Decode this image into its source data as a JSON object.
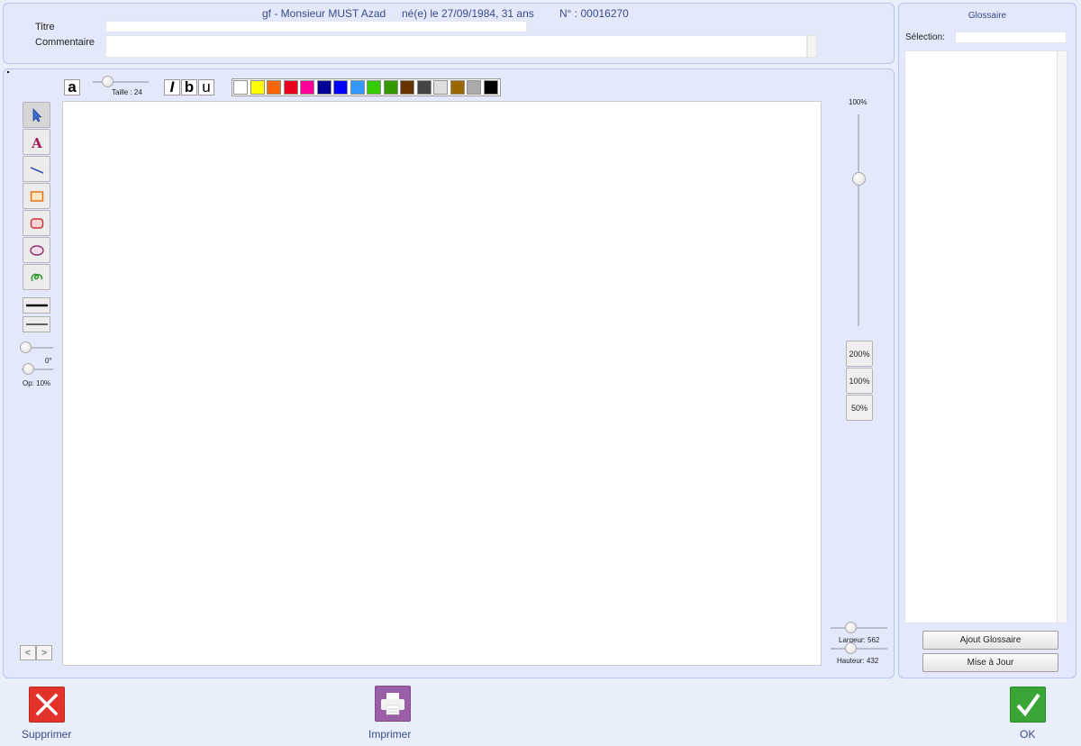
{
  "header": {
    "patient_prefix": "gf - Monsieur MUST Azad",
    "birth_info": "né(e) le 27/09/1984, 31 ans",
    "record_number": "N° : 00016270",
    "title_label": "Titre",
    "title_value": "",
    "comment_label": "Commentaire",
    "comment_value": ""
  },
  "toolbar": {
    "font_sample": "a",
    "size_label": "Taille : 24",
    "italic_label": "I",
    "bold_label": "b",
    "underline_label": "u",
    "rotation_label": "0°",
    "opacity_label": "Op: 10%",
    "tools": [
      "select-arrow-icon",
      "text-tool-icon",
      "line-tool-icon",
      "rectangle-tool-icon",
      "rounded-rectangle-tool-icon",
      "ellipse-tool-icon",
      "freehand-tool-icon"
    ],
    "colors": [
      "#ffffff",
      "#ffff00",
      "#ff6600",
      "#e8001c",
      "#ff0099",
      "#000099",
      "#0000ff",
      "#3399ff",
      "#33cc00",
      "#339900",
      "#663300",
      "#444444",
      "#dddddd",
      "#996600",
      "#aaaaaa",
      "#000000"
    ],
    "accent_color": "#3b4a88"
  },
  "zoom": {
    "current_label": "100%",
    "level": 0.3,
    "presets": [
      "200%",
      "100%",
      "50%"
    ]
  },
  "dimensions": {
    "width_label": "Largeur: 562",
    "height_label": "Hauteur: 432"
  },
  "glossary": {
    "title": "Glossaire",
    "selection_label": "Sélection:",
    "selection_value": "",
    "add_button": "Ajout Glossaire",
    "update_button": "Mise à Jour"
  },
  "actions": {
    "delete_label": "Supprimer",
    "print_label": "Imprimer",
    "ok_label": "OK"
  },
  "nav": {
    "prev_label": "<",
    "next_label": ">"
  }
}
